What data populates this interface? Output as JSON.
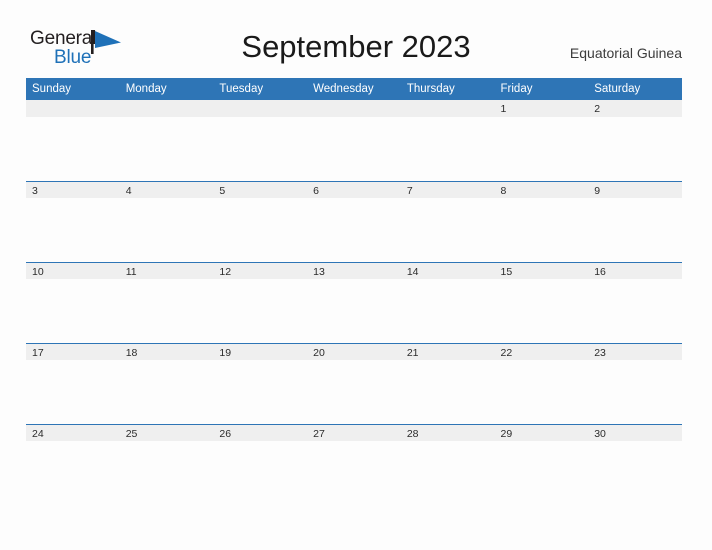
{
  "brand": {
    "name_part1": "General",
    "name_part2": "Blue",
    "flag_icon": "blue-flag-triangle",
    "accent_color": "#1f71b8"
  },
  "header": {
    "title": "September 2023",
    "region": "Equatorial Guinea"
  },
  "calendar": {
    "month": "September",
    "year": "2023",
    "header_bg_color": "#2e75b6",
    "date_band_color": "#efefef",
    "weekday_headers": [
      "Sunday",
      "Monday",
      "Tuesday",
      "Wednesday",
      "Thursday",
      "Friday",
      "Saturday"
    ],
    "weeks": [
      [
        "",
        "",
        "",
        "",
        "",
        "1",
        "2"
      ],
      [
        "3",
        "4",
        "5",
        "6",
        "7",
        "8",
        "9"
      ],
      [
        "10",
        "11",
        "12",
        "13",
        "14",
        "15",
        "16"
      ],
      [
        "17",
        "18",
        "19",
        "20",
        "21",
        "22",
        "23"
      ],
      [
        "24",
        "25",
        "26",
        "27",
        "28",
        "29",
        "30"
      ]
    ]
  }
}
